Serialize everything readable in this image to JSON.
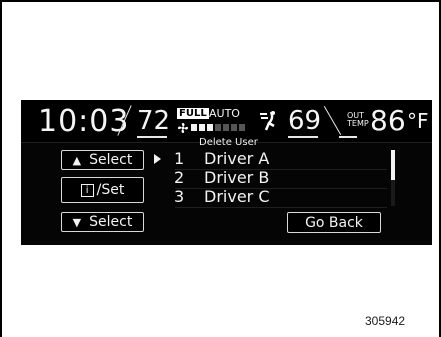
{
  "status_bar": {
    "clock": "10:03",
    "left_temp": "72",
    "fan_mode_badge": "FULL",
    "fan_mode": "AUTO",
    "fan_speed_level": 3,
    "fan_speed_max": 7,
    "right_temp": "69",
    "out_temp_label_line1": "OUT",
    "out_temp_label_line2": "TEMP",
    "outside_temp_value": "86",
    "outside_temp_unit": "°F"
  },
  "screen": {
    "title": "Delete User"
  },
  "buttons": {
    "select_up": "Select",
    "info_set": "/Set",
    "info_icon_text": "i",
    "select_down": "Select",
    "go_back": "Go Back"
  },
  "users": [
    {
      "number": "1",
      "name": "Driver A"
    },
    {
      "number": "2",
      "name": "Driver B"
    },
    {
      "number": "3",
      "name": "Driver C"
    }
  ],
  "selected_user_index": 0,
  "figure_id": "305942",
  "icons": {
    "up_arrow": "triangle-up-icon",
    "down_arrow": "triangle-down-icon",
    "selector": "play-arrow-icon",
    "fan": "fan-icon",
    "airflow": "seat-airflow-icon"
  }
}
